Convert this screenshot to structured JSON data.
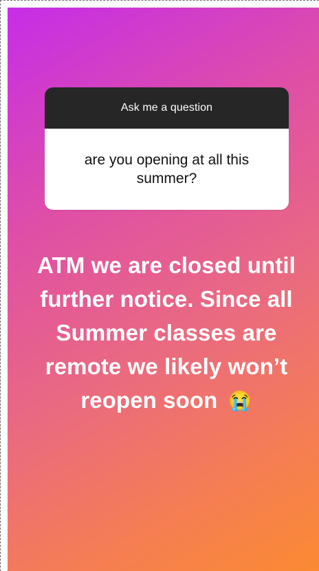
{
  "question_sticker": {
    "header": "Ask me a question",
    "question": "are you opening at all this summer?"
  },
  "answer": {
    "text": "ATM we are closed until further notice. Since all Summer classes are remote we likely won’t reopen soon",
    "emoji": "😭",
    "emoji_name": "loudly-crying-face-emoji"
  },
  "colors": {
    "gradient_top_left": "#c62de8",
    "gradient_mid": "#e36a82",
    "gradient_bottom_right": "#fb8a32",
    "sticker_header_bg": "#262626",
    "sticker_body_bg": "#ffffff",
    "answer_text": "#ffffff"
  }
}
